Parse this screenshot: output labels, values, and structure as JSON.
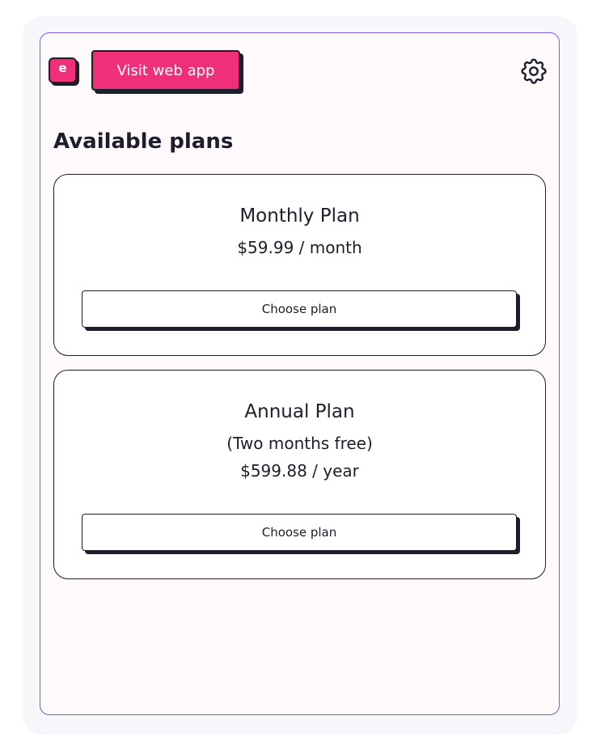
{
  "header": {
    "logo_letter": "e",
    "visit_label": "Visit web app",
    "settings_icon": "gear-icon"
  },
  "section": {
    "title": "Available plans"
  },
  "plans": [
    {
      "name": "Monthly Plan",
      "note": "",
      "price": "$59.99 / month",
      "button_label": "Choose plan"
    },
    {
      "name": "Annual Plan",
      "note": "(Two months free)",
      "price": "$599.88 / year",
      "button_label": "Choose plan"
    }
  ],
  "colors": {
    "accent": "#ef2f78",
    "panel_border": "#7e5ad8",
    "ink": "#1f1d2b"
  }
}
